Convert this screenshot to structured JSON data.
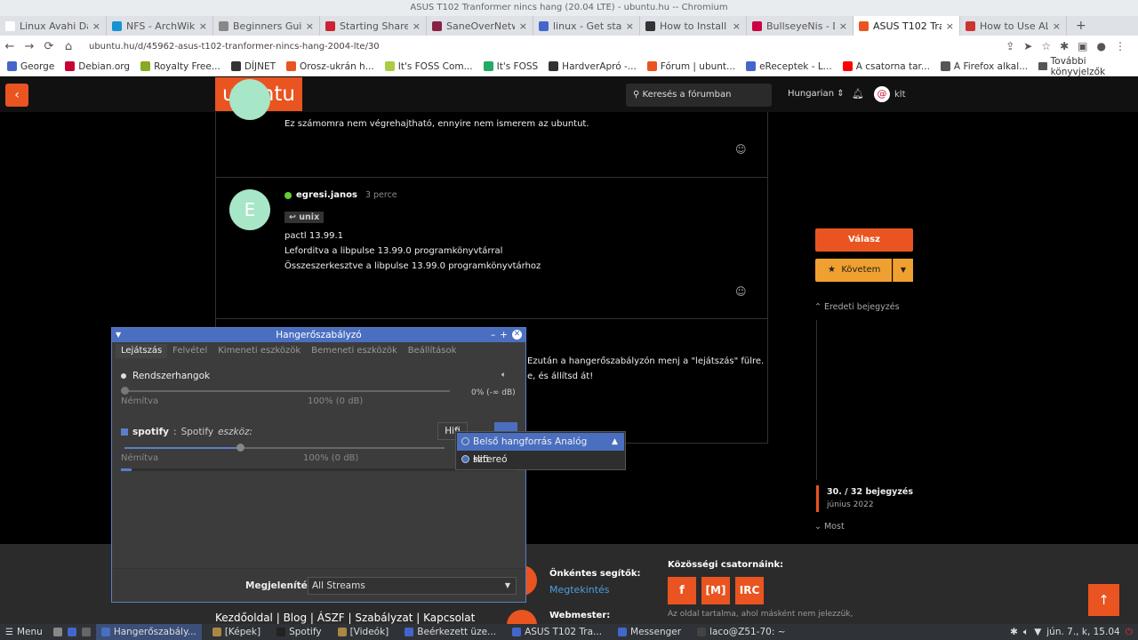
{
  "window_title": "ASUS T102 Tranformer nincs hang (20.04 LTE) - ubuntu.hu -- Chromium",
  "tabs": [
    {
      "label": "Linux Avahi Da",
      "color": "#ffffff"
    },
    {
      "label": "NFS - ArchWiki",
      "color": "#1793d1"
    },
    {
      "label": "Beginners Guid",
      "color": "#888888"
    },
    {
      "label": "Starting Share",
      "color": "#cc2233"
    },
    {
      "label": "SaneOverNetw",
      "color": "#882244"
    },
    {
      "label": "linux - Get stat",
      "color": "#4466cc"
    },
    {
      "label": "How to Install a",
      "color": "#333333"
    },
    {
      "label": "BullseyeNis - D",
      "color": "#cc0044"
    },
    {
      "label": "ASUS T102 Tra",
      "color": "#e95420"
    },
    {
      "label": "How to Use AL",
      "color": "#cc3333"
    }
  ],
  "address": {
    "url": "ubuntu.hu/d/45962-asus-t102-tranformer-nincs-hang-2004-lte/30"
  },
  "bookmarks": [
    {
      "label": "George",
      "color": "#4466cc"
    },
    {
      "label": "Debian.org",
      "color": "#c70036"
    },
    {
      "label": "Royalty Free...",
      "color": "#88aa22"
    },
    {
      "label": "DÍJNET",
      "color": "#333333"
    },
    {
      "label": "Orosz-ukrán h...",
      "color": "#e95420"
    },
    {
      "label": "It's FOSS Com...",
      "color": "#aacc44"
    },
    {
      "label": "It's FOSS",
      "color": "#22aa66"
    },
    {
      "label": "HardverApró -...",
      "color": "#333333"
    },
    {
      "label": "Fórum | ubunt...",
      "color": "#e95420"
    },
    {
      "label": "eReceptek - L...",
      "color": "#4466cc"
    },
    {
      "label": "A csatorna tar...",
      "color": "#ff0000"
    },
    {
      "label": "A Firefox alkal...",
      "color": "#555555"
    }
  ],
  "bookmarks_more": "További könyvjelzők",
  "site": {
    "logo": "ubuntu",
    "search_placeholder": "Keresés a fórumban",
    "language": "Hungarian",
    "username": "klt"
  },
  "posts": [
    {
      "text": "Ez számomra nem végrehajtható, ennyire nem ismerem az ubuntut."
    },
    {
      "avatar_letter": "E",
      "author": "egresi.janos",
      "time": "3 perce",
      "reply_to": "unix",
      "lines": [
        "pactl 13.99.1",
        "Leforditva a libpulse 13.99.0 programkönyvtárral",
        "Összeszerkesztve a libpulse 13.99.0 programkönyvtárhoz"
      ]
    },
    {
      "line1": "Ezután a hangerőszabályzón menj a \"lejátszás\" fülre.",
      "line2": "e, és állítsd át!"
    }
  ],
  "sidebar": {
    "reply": "Válasz",
    "follow": "Követem",
    "original": "Eredeti bejegyzés",
    "post_count": "30. / 32 bejegyzés",
    "post_date": "június 2022",
    "latest": "Most"
  },
  "footer": {
    "volunteers_title": "Önkéntes segítők:",
    "view_link": "Megtekintés",
    "community_title": "Közösségi csatornáink:",
    "social": [
      "f",
      "[M]",
      "IRC"
    ],
    "webmaster_title": "Webmester:",
    "disclaimer": "Az oldal tartalma, ahol másként nem jelezzük,",
    "links": "Kezdőoldal | Blog | ÁSZF | Szabályzat | Kapcsolat"
  },
  "pavucontrol": {
    "title": "Hangerőszabályzó",
    "tabs": [
      "Lejátszás",
      "Felvétel",
      "Kimeneti eszközök",
      "Bemeneti eszközök",
      "Beállítások"
    ],
    "streams": [
      {
        "name": "Rendszerhangok",
        "mute_label": "Némítva",
        "level_label": "100% (0 dB)",
        "right_label": "0% (-∞ dB)",
        "level": 0.0
      },
      {
        "app": "spotify",
        "name": "Spotify",
        "device_word": "eszköz:",
        "device_button": "Hifi",
        "mute_label": "Némítva",
        "level_label": "100% (0 dB)",
        "level": 0.36
      }
    ],
    "display_label": "Megjelenítés:",
    "display_value": "All Streams",
    "menu": [
      {
        "label": "Belső hangforrás Analóg sztereó",
        "selected": false
      },
      {
        "label": "Hifi",
        "selected": true
      }
    ]
  },
  "taskbar": {
    "menu": "Menu",
    "items": [
      {
        "label": "Hangerőszabály...",
        "color": "#4a6fc0",
        "active": true
      },
      {
        "label": "[Képek]",
        "color": "#aa8844",
        "active": false
      },
      {
        "label": "Spotify",
        "color": "#222222",
        "active": false
      },
      {
        "label": "[Videók]",
        "color": "#aa8844",
        "active": false
      },
      {
        "label": "Beérkezett üze...",
        "color": "#4466cc",
        "active": false
      },
      {
        "label": "ASUS T102 Tra...",
        "color": "#4466cc",
        "active": false
      },
      {
        "label": "Messenger",
        "color": "#4466cc",
        "active": false
      },
      {
        "label": "laco@Z51-70: ~",
        "color": "#444444",
        "active": false
      }
    ],
    "clock": "jún. 7., k, 15.04"
  }
}
